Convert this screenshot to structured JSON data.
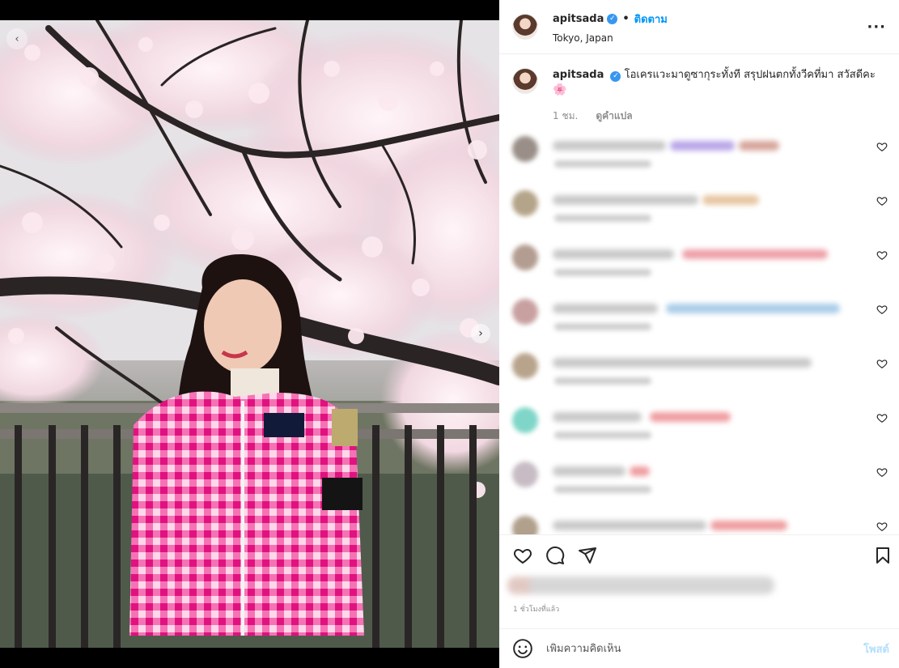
{
  "post": {
    "username": "apitsada",
    "separator": "•",
    "follow_label": "ติดตาม",
    "location": "Tokyo, Japan",
    "more_icon": "more-horizontal-icon"
  },
  "caption": {
    "username": "apitsada",
    "text": "โอเครแวะมาดูซากุระทั้งที สรุปฝนตกทั้งวีคที่มา สวัสดีคะ",
    "emoji": "🌸",
    "time": "1 ชม.",
    "translate_label": "ดูคำแปล"
  },
  "comments": [
    {
      "avatar": "#9a8f88",
      "name_color": "#c9c9c9",
      "highlight": "#b9a6e8"
    },
    {
      "avatar": "#b4a489",
      "name_color": "#c9c9c9",
      "highlight": "#e7c6a2"
    },
    {
      "avatar": "#b39c90",
      "name_color": "#c9c9c9",
      "highlight": "#eea0a8"
    },
    {
      "avatar": "#c9a0a0",
      "name_color": "#c9c9c9",
      "highlight": "#a9cde8"
    },
    {
      "avatar": "#b8a48c",
      "name_color": "#c9c9c9",
      "highlight": "#cfcfcf"
    },
    {
      "avatar": "#7fd6c8",
      "name_color": "#c9c9c9",
      "highlight": "#ef9da0"
    },
    {
      "avatar": "#c7bcc4",
      "name_color": "#c9c9c9",
      "highlight": "#ef9da0"
    },
    {
      "avatar": "#b0a08c",
      "name_color": "#c9c9c9",
      "highlight": "#ef9da0"
    }
  ],
  "footer": {
    "time_ago": "1 ชั่วโมงที่แล้ว",
    "comment_placeholder": "เพิ่มความคิดเห็น",
    "post_label": "โพสต์"
  },
  "colors": {
    "accent": "#0095f6",
    "verified": "#3797f0",
    "post_disabled": "#b2dffc"
  }
}
